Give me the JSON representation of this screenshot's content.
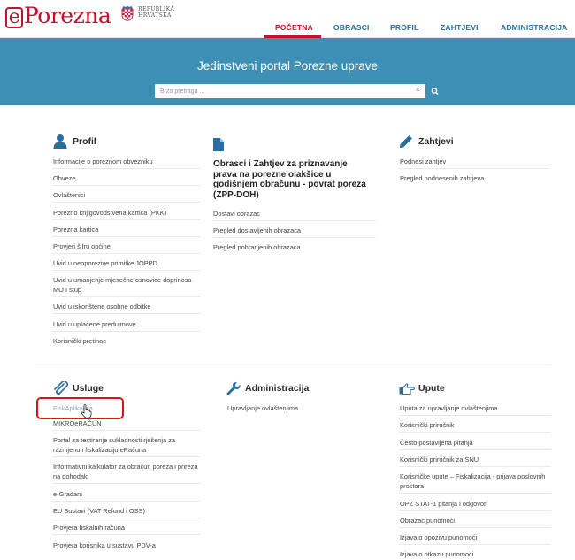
{
  "header": {
    "logo_e": "e",
    "logo_rest": "Porezna",
    "republika_line1": "REPUBLIKA",
    "republika_line2": "HRVATSKA",
    "nav": [
      "POČETNA",
      "OBRASCI",
      "PROFIL",
      "ZAHTJEVI",
      "ADMINISTRACIJA"
    ],
    "active_nav": "POČETNA"
  },
  "banner": {
    "title": "Jedinstveni portal Porezne uprave",
    "search_placeholder": "Brza pretraga ...",
    "clear_icon": "×"
  },
  "profil": {
    "title": "Profil",
    "icon": "user-icon",
    "items": [
      "Informacije o poreznom obvezniku",
      "Obveze",
      "Ovlaštenici",
      "Porezno knjigovodstvena kartica (PKK)",
      "Porezna kartica",
      "Provjeri šifru općine",
      "Uvid u neoporezive primitke JOPPD",
      "Uvid u umanjenje mjesečne osnovice doprinosa",
      "MO I stup",
      "Uvid u iskorištene osobne odbitke",
      "Uvid u uplaćene predujmove",
      "Korisnički pretinac"
    ]
  },
  "obrasci": {
    "icon": "document-icon",
    "title_lines": [
      "Obrasci i Zahtjev za priznavanje",
      "prava na porezne olakšice u",
      "godišnjem obračunu - povrat poreza",
      "(ZPP-DOH)"
    ],
    "items": [
      "Dostavi obrazac",
      "Pregled dostavljenih obrazaca",
      "Pregled pohranjenih obrazaca"
    ]
  },
  "zahtjevi": {
    "title": "Zahtjevi",
    "icon": "pencil-icon",
    "items": [
      "Podnesi zahtjev",
      "Pregled podnesenih zahtjeva"
    ]
  },
  "usluge": {
    "title": "Usluge",
    "icon": "paperclip-icon",
    "items": [
      "FiskAplikacija",
      "MIKROeRAČUN",
      "Portal za testiranje sukladnosti rješenja za",
      "razmjenu i fiskalizaciju eRačuna",
      "Informativni kalkulator za obračun poreza i prireza",
      "na dohodak",
      "e-Građani",
      "EU Sustavi (VAT Refund i OSS)",
      "Provjera fiskalnih računa",
      "Provjera korisnika u sustavu PDV-a"
    ]
  },
  "administracija": {
    "title": "Administracija",
    "icon": "wrench-icon",
    "items": [
      "Upravljanje ovlaštenjima"
    ]
  },
  "upute": {
    "title": "Upute",
    "icon": "pointing-hand-icon",
    "items": [
      "Uputa za upravljanje ovlaštenjima",
      "Korisnički priručnik",
      "Često postavljena pitanja",
      "Korisnički priručnik za SNU",
      "Korisničke upute – Fiskalizacija - prijava poslovnih",
      "prostora",
      "OPZ STAT-1 pitanja i odgovori",
      "Obrazac punomoći",
      "Izjava o opozivu punomoći",
      "Izjava o otkazu punomoći"
    ]
  },
  "colors": {
    "brand_red": "#c8102e",
    "banner_blue": "#3e8fb6",
    "nav_blue": "#2a6e9e",
    "highlight_red": "#d01818"
  }
}
